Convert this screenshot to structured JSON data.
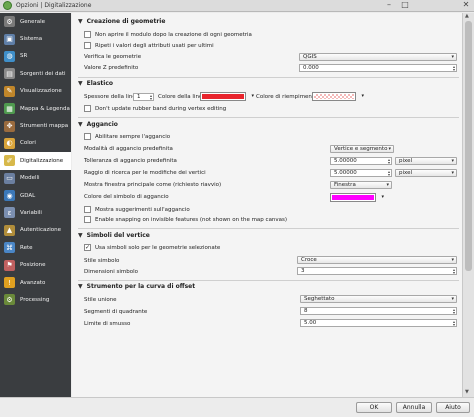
{
  "window": {
    "title": "Opzioni | Digitalizzazione"
  },
  "sidebar": {
    "items": [
      {
        "label": "Generale",
        "icon": "gear-icon",
        "color": "#7a7a7a"
      },
      {
        "label": "Sistema",
        "icon": "system-icon",
        "color": "#5f7fa8"
      },
      {
        "label": "SR",
        "icon": "crs-globe-icon",
        "color": "#3f8fc9"
      },
      {
        "label": "Sorgenti dei dati",
        "icon": "data-sources-icon",
        "color": "#8a8a8a"
      },
      {
        "label": "Visualizzazione",
        "icon": "paintbrush-icon",
        "color": "#c0862a"
      },
      {
        "label": "Mappa & Legenda",
        "icon": "map-legend-icon",
        "color": "#4f9a4f"
      },
      {
        "label": "Strumenti mappa",
        "icon": "map-tools-icon",
        "color": "#9a6b3e"
      },
      {
        "label": "Colori",
        "icon": "palette-icon",
        "color": "#d9a43a"
      },
      {
        "label": "Digitalizzazione",
        "icon": "digitizing-icon",
        "color": "#d7b84a"
      },
      {
        "label": "Modelli",
        "icon": "layouts-icon",
        "color": "#6b7fa0"
      },
      {
        "label": "GDAL",
        "icon": "gdal-icon",
        "color": "#3b78b8"
      },
      {
        "label": "Variabili",
        "icon": "variables-icon",
        "color": "#7b8fb0"
      },
      {
        "label": "Autenticazione",
        "icon": "lock-icon",
        "color": "#b08d3a"
      },
      {
        "label": "Rete",
        "icon": "network-icon",
        "color": "#4a86c6"
      },
      {
        "label": "Posizione",
        "icon": "locale-flag-icon",
        "color": "#c06060"
      },
      {
        "label": "Avanzato",
        "icon": "warning-icon",
        "color": "#e0a020"
      },
      {
        "label": "Processing",
        "icon": "processing-gear-icon",
        "color": "#6a8a3a"
      }
    ],
    "selected": "Digitalizzazione"
  },
  "creazione": {
    "title": "Creazione di geometrie",
    "no_form_label": "Non aprire il modulo dopo la creazione di ogni geometria",
    "reuse_label": "Ripeti i valori degli attributi usati per ultimi",
    "validate_label": "Verifica le geometrie",
    "validate_value": "QGIS",
    "zvalue_label": "Valore Z predefinito",
    "zvalue_value": "0.000"
  },
  "elastico": {
    "title": "Elastico",
    "width_label": "Spessore della linea",
    "width_value": "1",
    "line_color_label": "Colore della linea",
    "line_color": "#e8242c",
    "fill_color_label": "Colore di riempimento",
    "fill_color": "#f4b8b8",
    "no_update_label": "Don't update rubber band during vertex editing"
  },
  "aggancio": {
    "title": "Aggancio",
    "enable_label": "Abilitare sempre l'aggancio",
    "mode_label": "Modalità di aggancio predefinita",
    "mode_value": "Vertice e segmento",
    "tolerance_label": "Tolleranza di aggancio predefinita",
    "tolerance_value": "5.00000",
    "tolerance_unit": "pixel",
    "radius_label": "Raggio di ricerca per le modifiche dei vertici",
    "radius_value": "5.00000",
    "radius_unit": "pixel",
    "window_label": "Mostra finestra principale come (richiesto riavvio)",
    "window_value": "Finestra",
    "marker_color_label": "Colore del simbolo di aggancio",
    "marker_color": "#ff00ff",
    "tooltips_label": "Mostra suggerimenti sull'aggancio",
    "invisible_label": "Enable snapping on invisible features (not shown on the map canvas)"
  },
  "simboli": {
    "title": "Simboli del vertice",
    "selected_only_label": "Usa simboli solo per le geometrie selezionate",
    "style_label": "Stile simbolo",
    "style_value": "Croce",
    "size_label": "Dimensioni simbolo",
    "size_value": "3"
  },
  "offset": {
    "title": "Strumento per la curva di offset",
    "join_label": "Stile unione",
    "join_value": "Seghettato",
    "segments_label": "Segmenti di quadrante",
    "segments_value": "8",
    "miter_label": "Limite di smusso",
    "miter_value": "5.00"
  },
  "buttons": {
    "ok": "OK",
    "cancel": "Annulla",
    "help": "Aiuto"
  }
}
